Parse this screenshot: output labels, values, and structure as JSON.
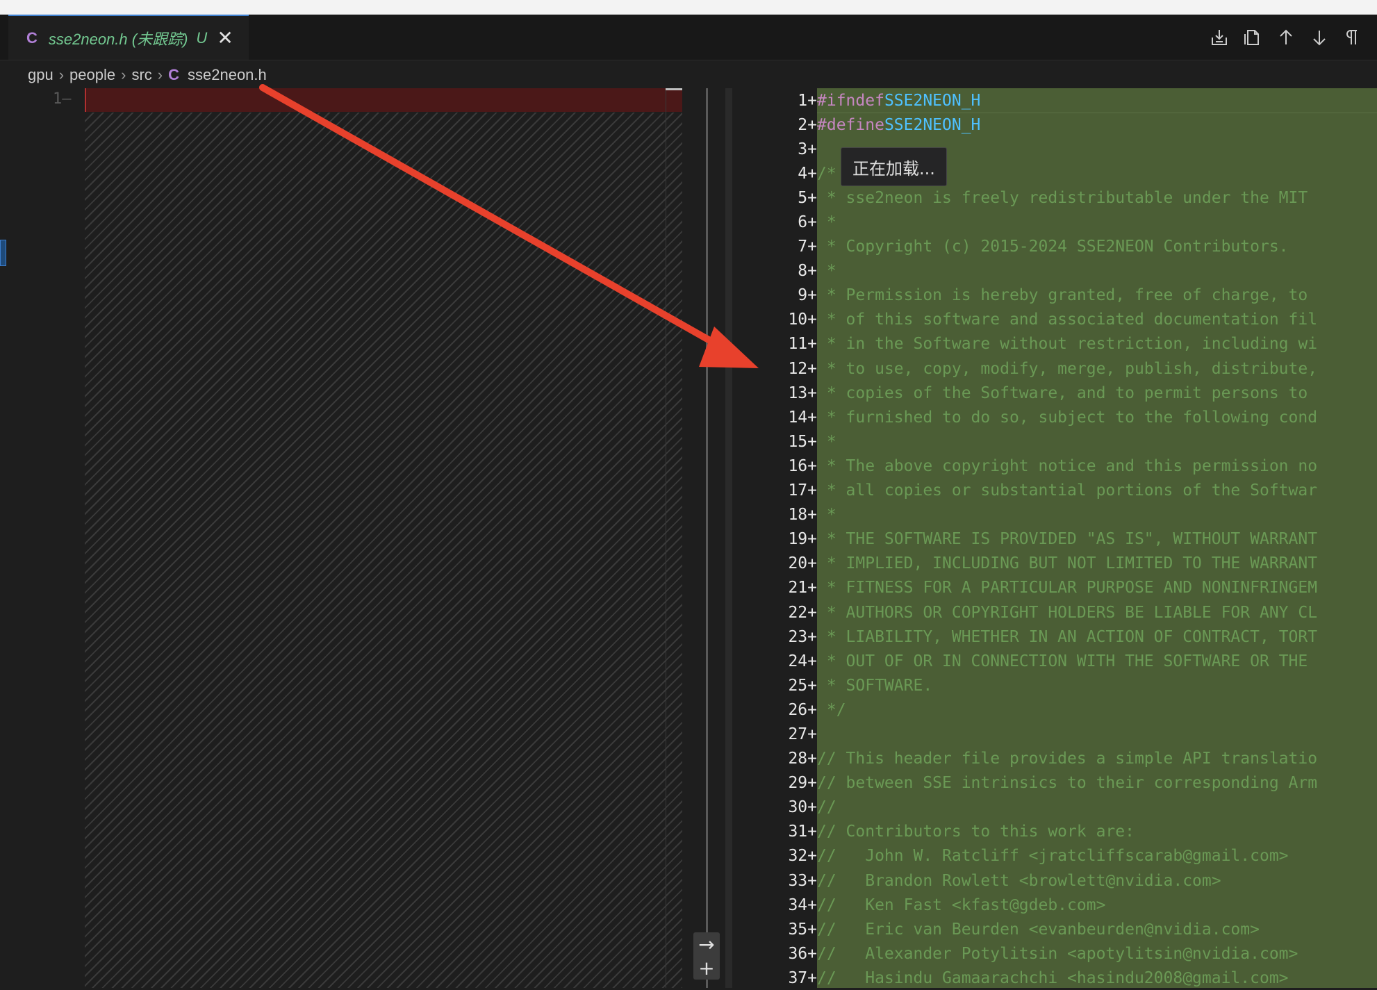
{
  "tab": {
    "lang_icon": "C",
    "title": "sse2neon.h (未跟踪)",
    "status": "U",
    "close_glyph": "✕"
  },
  "toolbar": {
    "icons": [
      "stage-changes-icon",
      "open-file-icon",
      "previous-change-icon",
      "next-change-icon",
      "toggle-whitespace-icon"
    ]
  },
  "breadcrumb": {
    "items": [
      "gpu",
      "people",
      "src"
    ],
    "file_icon": "C",
    "file": "sse2neon.h"
  },
  "left_editor": {
    "line_label": "1—"
  },
  "tooltip": "正在加载...",
  "revert": {
    "arrow": "→",
    "plus": "+"
  },
  "diff_lines": [
    {
      "n": "1+",
      "text": "#ifndef SSE2NEON_H"
    },
    {
      "n": "2+",
      "text": "#define SSE2NEON_H"
    },
    {
      "n": "3+",
      "text": ""
    },
    {
      "n": "4+",
      "text": "/*"
    },
    {
      "n": "5+",
      "text": " * sse2neon is freely redistributable under the MIT"
    },
    {
      "n": "6+",
      "text": " *"
    },
    {
      "n": "7+",
      "text": " * Copyright (c) 2015-2024 SSE2NEON Contributors."
    },
    {
      "n": "8+",
      "text": " *"
    },
    {
      "n": "9+",
      "text": " * Permission is hereby granted, free of charge, to"
    },
    {
      "n": "10+",
      "text": " * of this software and associated documentation fil"
    },
    {
      "n": "11+",
      "text": " * in the Software without restriction, including wi"
    },
    {
      "n": "12+",
      "text": " * to use, copy, modify, merge, publish, distribute,"
    },
    {
      "n": "13+",
      "text": " * copies of the Software, and to permit persons to"
    },
    {
      "n": "14+",
      "text": " * furnished to do so, subject to the following cond"
    },
    {
      "n": "15+",
      "text": " *"
    },
    {
      "n": "16+",
      "text": " * The above copyright notice and this permission no"
    },
    {
      "n": "17+",
      "text": " * all copies or substantial portions of the Softwar"
    },
    {
      "n": "18+",
      "text": " *"
    },
    {
      "n": "19+",
      "text": " * THE SOFTWARE IS PROVIDED \"AS IS\", WITHOUT WARRANT"
    },
    {
      "n": "20+",
      "text": " * IMPLIED, INCLUDING BUT NOT LIMITED TO THE WARRANT"
    },
    {
      "n": "21+",
      "text": " * FITNESS FOR A PARTICULAR PURPOSE AND NONINFRINGEM"
    },
    {
      "n": "22+",
      "text": " * AUTHORS OR COPYRIGHT HOLDERS BE LIABLE FOR ANY CL"
    },
    {
      "n": "23+",
      "text": " * LIABILITY, WHETHER IN AN ACTION OF CONTRACT, TORT"
    },
    {
      "n": "24+",
      "text": " * OUT OF OR IN CONNECTION WITH THE SOFTWARE OR THE"
    },
    {
      "n": "25+",
      "text": " * SOFTWARE."
    },
    {
      "n": "26+",
      "text": " */"
    },
    {
      "n": "27+",
      "text": ""
    },
    {
      "n": "28+",
      "text": "// This header file provides a simple API translatio"
    },
    {
      "n": "29+",
      "text": "// between SSE intrinsics to their corresponding Arm"
    },
    {
      "n": "30+",
      "text": "//"
    },
    {
      "n": "31+",
      "text": "// Contributors to this work are:"
    },
    {
      "n": "32+",
      "text": "//   John W. Ratcliff <jratcliffscarab@gmail.com>"
    },
    {
      "n": "33+",
      "text": "//   Brandon Rowlett <browlett@nvidia.com>"
    },
    {
      "n": "34+",
      "text": "//   Ken Fast <kfast@gdeb.com>"
    },
    {
      "n": "35+",
      "text": "//   Eric van Beurden <evanbeurden@nvidia.com>"
    },
    {
      "n": "36+",
      "text": "//   Alexander Potylitsin <apotylitsin@nvidia.com>"
    },
    {
      "n": "37+",
      "text": "//   Hasindu Gamaarachchi <hasindu2008@gmail.com>"
    }
  ],
  "colors": {
    "added_bg": "#4b5e35",
    "removed_bg": "#4b1818",
    "annotation_arrow": "#e8412c"
  }
}
